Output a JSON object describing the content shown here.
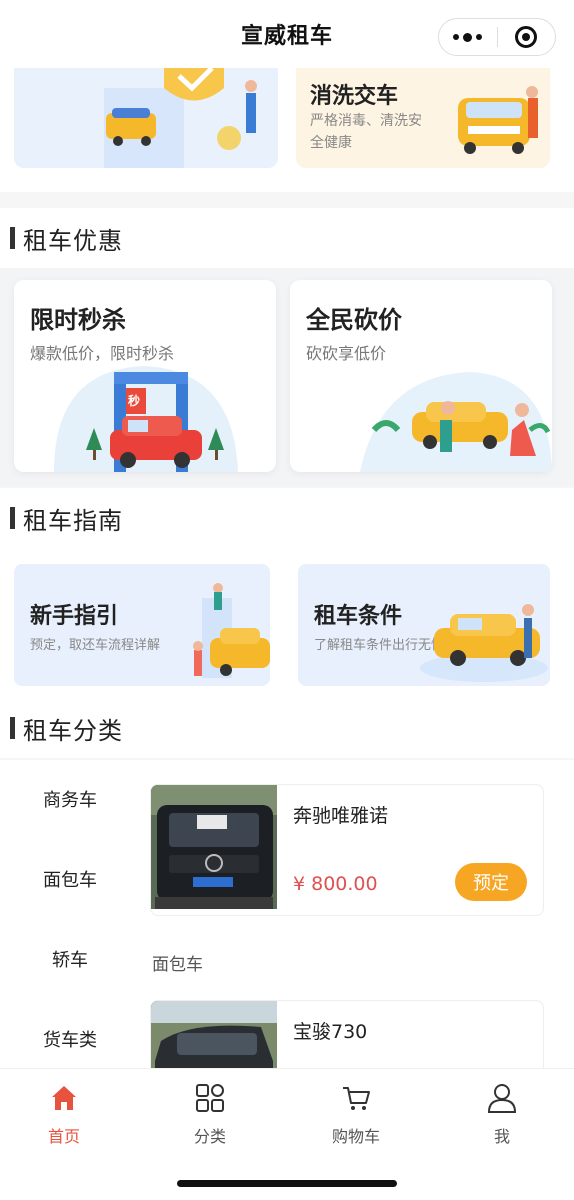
{
  "header": {
    "title": "宣威租车"
  },
  "services": {
    "left": {
      "title": ""
    },
    "right": {
      "title": "消洗交车",
      "desc": "严格消毒、清洗安全健康"
    }
  },
  "sections": {
    "promo": "租车优惠",
    "guide": "租车指南",
    "category": "租车分类"
  },
  "promos": [
    {
      "title": "限时秒杀",
      "desc": "爆款低价，限时秒杀",
      "sign": "秒"
    },
    {
      "title": "全民砍价",
      "desc": "砍砍享低价"
    }
  ],
  "guides": [
    {
      "title": "新手指引",
      "desc": "预定，取还车流程详解"
    },
    {
      "title": "租车条件",
      "desc": "了解租车条件出行无忧"
    }
  ],
  "categories": [
    "商务车",
    "面包车",
    "轿车",
    "货车类"
  ],
  "products": [
    {
      "name": "奔驰唯雅诺",
      "price": "¥ 800.00",
      "button": "预定"
    },
    {
      "name": "宝骏730"
    }
  ],
  "group_label": "面包车",
  "tabs": [
    {
      "label": "首页",
      "icon": "home-icon",
      "active": true
    },
    {
      "label": "分类",
      "icon": "grid-icon",
      "active": false
    },
    {
      "label": "购物车",
      "icon": "cart-icon",
      "active": false
    },
    {
      "label": "我",
      "icon": "user-icon",
      "active": false
    }
  ],
  "colors": {
    "accent": "#e8533f",
    "button": "#f6a623",
    "price": "#e05050"
  }
}
